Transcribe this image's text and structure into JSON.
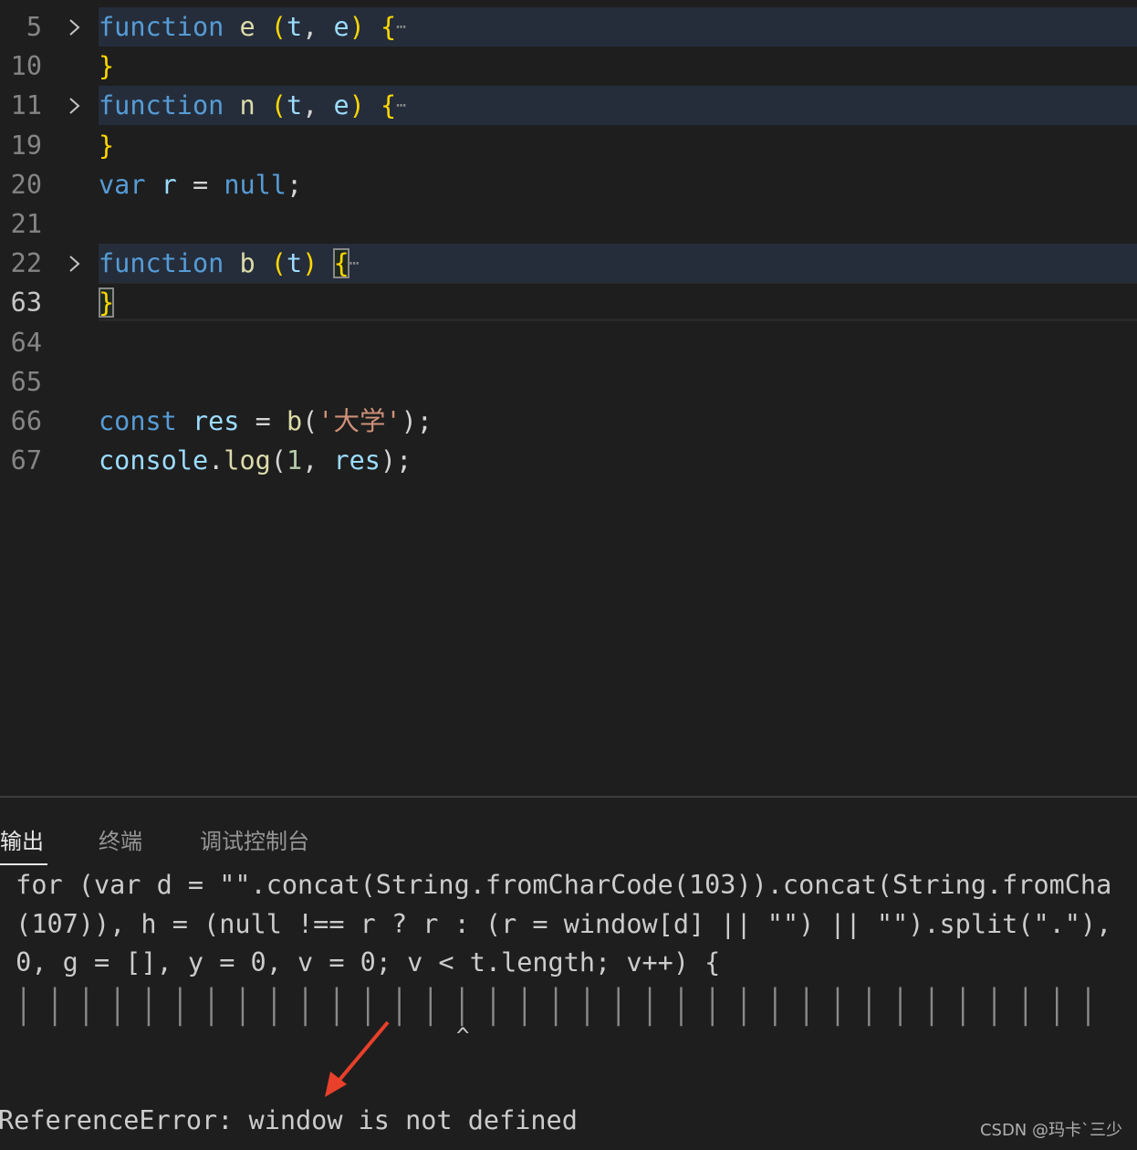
{
  "editor": {
    "active_line": "63",
    "lines": [
      {
        "n": "5",
        "folded": true,
        "tokens": [
          [
            "kw",
            "function"
          ],
          [
            "pl",
            " "
          ],
          [
            "fn",
            "e"
          ],
          [
            "pl",
            " "
          ],
          [
            "br",
            "("
          ],
          [
            "pa",
            "t"
          ],
          [
            "pl",
            ", "
          ],
          [
            "pa",
            "e"
          ],
          [
            "br",
            ")"
          ],
          [
            "pl",
            " "
          ],
          [
            "br",
            "{"
          ],
          [
            "el",
            "⋯"
          ]
        ]
      },
      {
        "n": "10",
        "tokens": [
          [
            "br",
            "}"
          ]
        ]
      },
      {
        "n": "11",
        "folded": true,
        "tokens": [
          [
            "kw",
            "function"
          ],
          [
            "pl",
            " "
          ],
          [
            "fn",
            "n"
          ],
          [
            "pl",
            " "
          ],
          [
            "br",
            "("
          ],
          [
            "pa",
            "t"
          ],
          [
            "pl",
            ", "
          ],
          [
            "pa",
            "e"
          ],
          [
            "br",
            ")"
          ],
          [
            "pl",
            " "
          ],
          [
            "br",
            "{"
          ],
          [
            "el",
            "⋯"
          ]
        ]
      },
      {
        "n": "19",
        "tokens": [
          [
            "br",
            "}"
          ]
        ]
      },
      {
        "n": "20",
        "tokens": [
          [
            "kw",
            "var"
          ],
          [
            "pl",
            " "
          ],
          [
            "pa",
            "r"
          ],
          [
            "pl",
            " = "
          ],
          [
            "kw",
            "null"
          ],
          [
            "pl",
            ";"
          ]
        ]
      },
      {
        "n": "21",
        "tokens": []
      },
      {
        "n": "22",
        "folded": true,
        "tokens": [
          [
            "kw",
            "function"
          ],
          [
            "pl",
            " "
          ],
          [
            "fn",
            "b"
          ],
          [
            "pl",
            " "
          ],
          [
            "br",
            "("
          ],
          [
            "pa",
            "t"
          ],
          [
            "br",
            ")"
          ],
          [
            "pl",
            " "
          ],
          [
            "br match",
            "{"
          ],
          [
            "el",
            "⋯"
          ]
        ]
      },
      {
        "n": "63",
        "tokens": [
          [
            "br match",
            "}"
          ]
        ]
      },
      {
        "n": "64",
        "tokens": []
      },
      {
        "n": "65",
        "tokens": []
      },
      {
        "n": "66",
        "tokens": [
          [
            "kw",
            "const"
          ],
          [
            "pl",
            " "
          ],
          [
            "pa",
            "res"
          ],
          [
            "pl",
            " = "
          ],
          [
            "fn",
            "b"
          ],
          [
            "pl",
            "("
          ],
          [
            "st",
            "'大学'"
          ],
          [
            "pl",
            ");"
          ]
        ]
      },
      {
        "n": "67",
        "tokens": [
          [
            "pa",
            "console"
          ],
          [
            "pl",
            "."
          ],
          [
            "fn",
            "log"
          ],
          [
            "pl",
            "("
          ],
          [
            "nu",
            "1"
          ],
          [
            "pl",
            ", "
          ],
          [
            "pa",
            "res"
          ],
          [
            "pl",
            ");"
          ]
        ]
      }
    ]
  },
  "panel": {
    "tabs": [
      {
        "label": "输出",
        "active": true
      },
      {
        "label": "终端"
      },
      {
        "label": "调试控制台"
      }
    ],
    "output": [
      " for (var d = \"\".concat(String.fromCharCode(103)).concat(String.fromCha",
      " (107)), h = (null !== r ? r : (r = window[d] || \"\") || \"\").split(\".\"),",
      " 0, g = [], y = 0, v = 0; v < t.length; v++) {"
    ],
    "pipes": " | | | | | | | | | | | | | | | | | | | | | | | | | | | | | | | | | | |",
    "caret": "^",
    "error": "ReferenceError: window is not defined"
  },
  "annotation": {
    "arrow_color": "#e8402a"
  },
  "watermark": "CSDN @玛卡`三少"
}
